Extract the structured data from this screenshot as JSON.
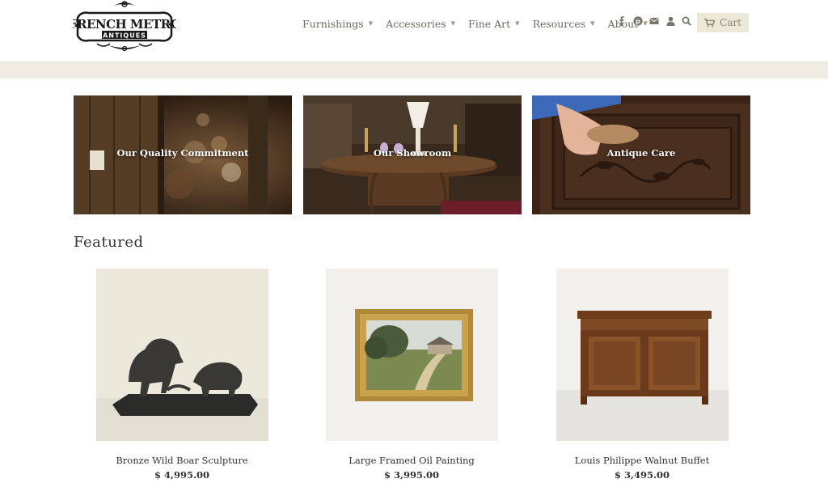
{
  "header": {
    "logo_text": "FRENCH METRO ANTIQUES",
    "nav": [
      {
        "label": "Furnishings"
      },
      {
        "label": "Accessories"
      },
      {
        "label": "Fine Art"
      },
      {
        "label": "Resources"
      },
      {
        "label": "About"
      }
    ],
    "icons": [
      "facebook-icon",
      "pinterest-icon",
      "mail-icon",
      "user-icon",
      "search-icon"
    ],
    "cart_label": "Cart"
  },
  "collections": [
    {
      "label": "Our Quality Commitment"
    },
    {
      "label": "Our Showroom"
    },
    {
      "label": "Antique Care"
    }
  ],
  "featured": {
    "title": "Featured",
    "products": [
      {
        "name": "Bronze Wild Boar Sculpture",
        "price": "$ 4,995.00"
      },
      {
        "name": "Large Framed Oil Painting",
        "price": "$ 3,995.00"
      },
      {
        "name": "Louis Philippe Walnut Buffet",
        "price": "$ 3,495.00"
      }
    ]
  },
  "colors": {
    "header_band": "#efece3",
    "cart_bg": "#ece8d8",
    "nav_text": "#6d6a63"
  }
}
